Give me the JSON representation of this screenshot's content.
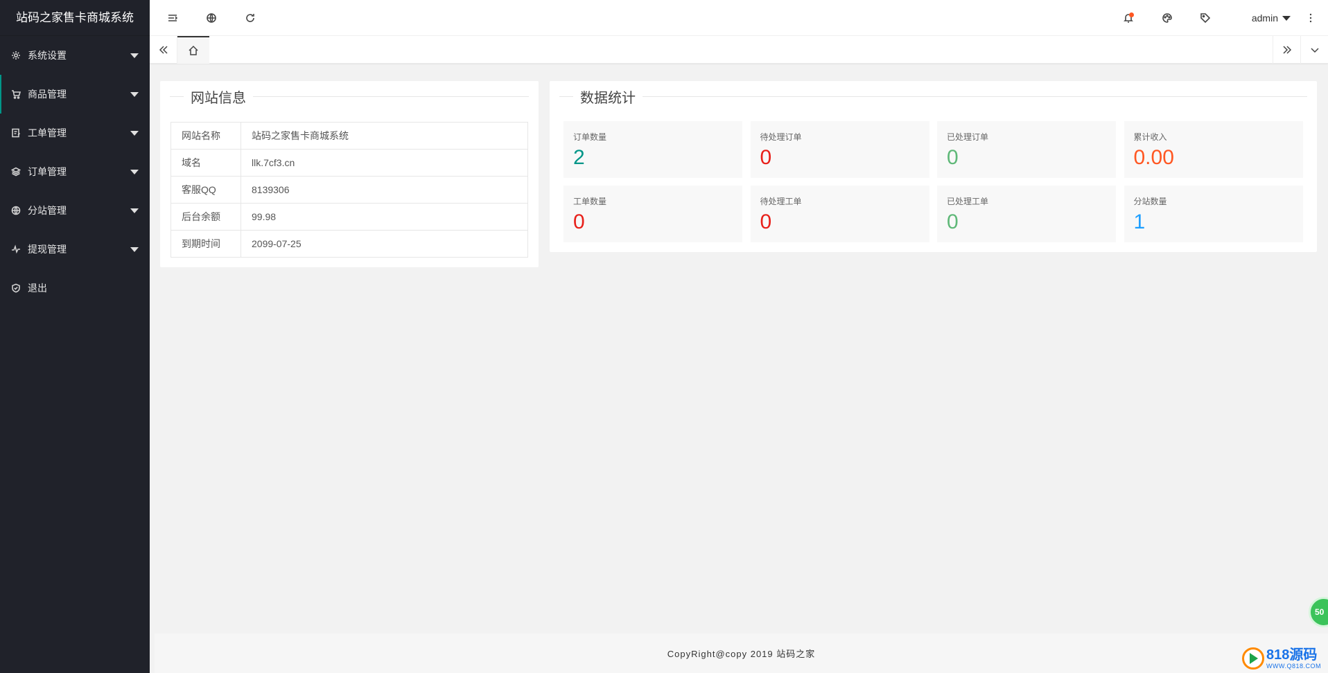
{
  "app": {
    "title": "站码之家售卡商城系统"
  },
  "sidebar": {
    "items": [
      {
        "label": "系统设置",
        "icon": "gear-icon",
        "has_submenu": true
      },
      {
        "label": "商品管理",
        "icon": "cart-icon",
        "has_submenu": true,
        "active": true
      },
      {
        "label": "工单管理",
        "icon": "ticket-icon",
        "has_submenu": true
      },
      {
        "label": "订单管理",
        "icon": "layers-icon",
        "has_submenu": true
      },
      {
        "label": "分站管理",
        "icon": "globe-icon",
        "has_submenu": true
      },
      {
        "label": "提现管理",
        "icon": "pulse-icon",
        "has_submenu": true
      },
      {
        "label": "退出",
        "icon": "shield-icon",
        "has_submenu": false
      }
    ]
  },
  "header": {
    "user": "admin",
    "icons": [
      "menu-collapse-icon",
      "globe-icon",
      "refresh-icon",
      "bell-icon",
      "palette-icon",
      "tag-icon",
      "more-vertical-icon"
    ]
  },
  "site_info": {
    "title": "网站信息",
    "rows": [
      {
        "key": "网站名称",
        "value": "站码之家售卡商城系统"
      },
      {
        "key": "域名",
        "value": "llk.7cf3.cn"
      },
      {
        "key": "客服QQ",
        "value": "8139306"
      },
      {
        "key": "后台余额",
        "value": "99.98"
      },
      {
        "key": "到期时间",
        "value": "2099-07-25"
      }
    ]
  },
  "stats": {
    "title": "数据统计",
    "items": [
      {
        "label": "订单数量",
        "value": "2",
        "color": "#009688"
      },
      {
        "label": "待处理订单",
        "value": "0",
        "color": "#e8201a"
      },
      {
        "label": "已处理订单",
        "value": "0",
        "color": "#5fb878"
      },
      {
        "label": "累计收入",
        "value": "0.00",
        "color": "#ff5722"
      },
      {
        "label": "工单数量",
        "value": "0",
        "color": "#e8201a"
      },
      {
        "label": "待处理工单",
        "value": "0",
        "color": "#e8201a"
      },
      {
        "label": "已处理工单",
        "value": "0",
        "color": "#5fb878"
      },
      {
        "label": "分站数量",
        "value": "1",
        "color": "#1e9fff"
      }
    ]
  },
  "footer": {
    "text": "CopyRight@copy 2019 站码之家"
  },
  "float_badge": {
    "text": "50"
  },
  "watermark": {
    "main": "818源码",
    "sub": "WWW.Q818.COM"
  }
}
